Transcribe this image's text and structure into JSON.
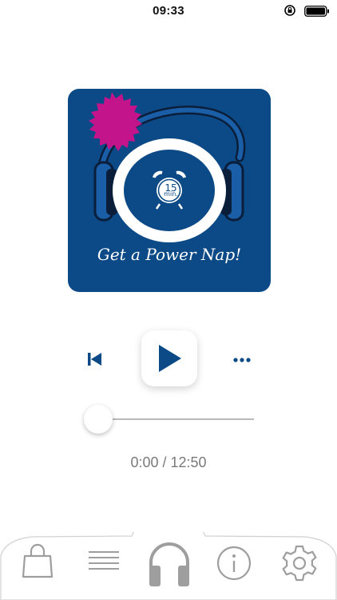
{
  "status_bar": {
    "time": "09:33"
  },
  "album": {
    "title": "Get a Power Nap!",
    "timer_number": "15",
    "timer_unit": "min."
  },
  "player": {
    "time_display": "0:00 / 12:50",
    "progress": 0.0
  },
  "tabs": [
    {
      "name": "shop",
      "icon": "shopping-bag-icon"
    },
    {
      "name": "list",
      "icon": "list-icon"
    },
    {
      "name": "player",
      "icon": "headphones-icon",
      "active": true
    },
    {
      "name": "info",
      "icon": "info-icon"
    },
    {
      "name": "settings",
      "icon": "gear-icon"
    }
  ],
  "colors": {
    "brand_blue": "#0b4a86",
    "accent_magenta": "#c4148c",
    "tab_gray": "#9e9e9e"
  }
}
